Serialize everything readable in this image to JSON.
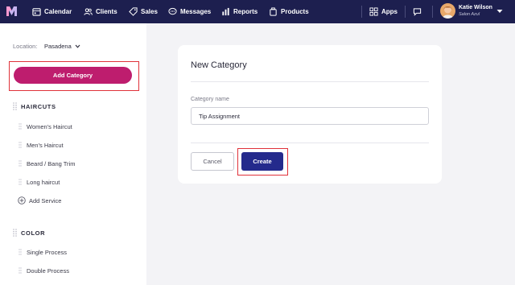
{
  "nav": {
    "items": [
      {
        "label": "Calendar",
        "icon": "calendar-icon"
      },
      {
        "label": "Clients",
        "icon": "clients-icon"
      },
      {
        "label": "Sales",
        "icon": "tag-icon"
      },
      {
        "label": "Messages",
        "icon": "message-icon"
      },
      {
        "label": "Reports",
        "icon": "reports-icon"
      },
      {
        "label": "Products",
        "icon": "products-icon"
      }
    ],
    "apps_label": "Apps",
    "user_name": "Katie Wilson",
    "salon_name": "Salon Azul",
    "brand_color": "#1d1f4f"
  },
  "sidebar": {
    "location_label": "Location:",
    "location_value": "Pasadena",
    "add_category_label": "Add Category",
    "add_category_color": "#be1d6e",
    "groups": [
      {
        "title": "HAIRCUTS",
        "services": [
          "Women's Haircut",
          "Men's Haircut",
          "Beard / Bang Trim",
          "Long haircut"
        ],
        "add_label": "Add Service"
      },
      {
        "title": "COLOR",
        "services": [
          "Single Process",
          "Double Process"
        ]
      }
    ]
  },
  "form": {
    "title": "New Category",
    "field_label": "Category name",
    "field_value": "Tip Assignment",
    "cancel_label": "Cancel",
    "create_label": "Create",
    "create_color": "#242a8c",
    "highlight_color": "#e0323a"
  }
}
